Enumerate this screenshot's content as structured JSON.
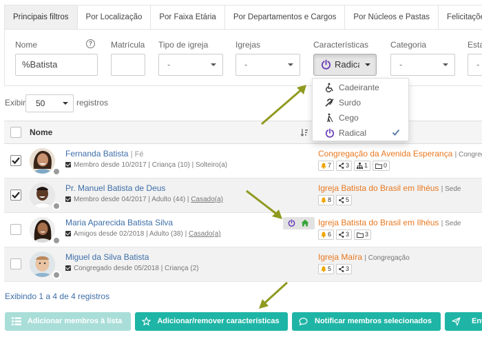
{
  "tabs": [
    "Principais filtros",
    "Por Localização",
    "Por Faixa Etária",
    "Por Departamentos e Cargos",
    "Por Núcleos e Pastas",
    "Felicitações"
  ],
  "filters": {
    "nome_label": "Nome",
    "nome_value": "%Batista",
    "matricula_label": "Matrícula",
    "tipo_igreja_label": "Tipo de igreja",
    "tipo_igreja_value": "-",
    "igrejas_label": "Igrejas",
    "igrejas_value": "-",
    "caracteristicas_label": "Características",
    "caracteristicas_value": "Radical",
    "categoria_label": "Categoria",
    "categoria_value": "-",
    "esta_label": "Esta",
    "esta_value": "-"
  },
  "caracteristicas_options": [
    {
      "label": "Cadeirante",
      "icon": "wheelchair-icon",
      "selected": false
    },
    {
      "label": "Surdo",
      "icon": "deaf-icon",
      "selected": false
    },
    {
      "label": "Cego",
      "icon": "blind-icon",
      "selected": false
    },
    {
      "label": "Radical",
      "icon": "power-icon",
      "selected": true
    }
  ],
  "paging": {
    "exibir_label": "Exibir",
    "per_page": "50",
    "registros_label": "registros",
    "summary": "Exibindo 1 a 4 de 4 registros"
  },
  "table": {
    "col_nome": "Nome",
    "rows": [
      {
        "checked": true,
        "name": "Fernanda Batista",
        "name_suffix": "| Fé",
        "meta": "Membro desde 10/2017 | Criança (10) | Solteiro(a)",
        "church": "Congregação da Avenida Esperança",
        "church_type": "| Congregação",
        "chips": [
          "7",
          "3",
          "1",
          "0"
        ]
      },
      {
        "checked": true,
        "name": "Pr. Manuel Batista de Deus",
        "name_suffix": "",
        "meta_prefix": "Membro desde 04/2017 | Adulto (44) | ",
        "meta_link": "Casado(a)",
        "church": "Igreja Batista do Brasil em Ilhéus",
        "church_type": "| Sede",
        "chips": [
          "8",
          "5"
        ]
      },
      {
        "checked": false,
        "name": "Maria Aparecida Batista Silva",
        "name_suffix": "",
        "meta_prefix": "Amigos desde 02/2018 | Adulto (38) | ",
        "meta_link": "Casado(a)",
        "church": "Igreja Batista do Brasil em Ilhéus",
        "church_type": "| Sede",
        "chips": [
          "6",
          "3",
          "3"
        ]
      },
      {
        "checked": false,
        "name": "Miguel da Silva Batista",
        "name_suffix": "",
        "meta": "Congregado desde 05/2018 | Criança (2)",
        "church": "Igreja Maíra",
        "church_type": "| Congregação",
        "chips": [
          "5",
          "3"
        ]
      }
    ]
  },
  "buttons": {
    "add_members": "Adicionar membros à lista",
    "add_remove_features": "Adicionar/remover características",
    "notify": "Notificar membros selecionados",
    "send": "Env"
  },
  "colors": {
    "accent": "#1fb5a6",
    "accent_disabled": "#a9ddd8",
    "link": "#3d6ea8",
    "church": "#e8771e",
    "power": "#6a3fb5",
    "arrow": "#8f9a1f"
  }
}
